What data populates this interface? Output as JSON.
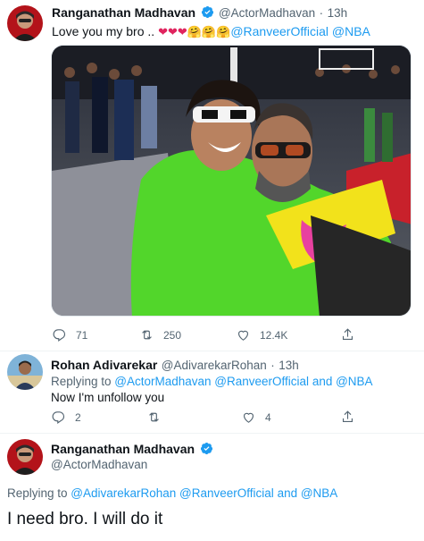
{
  "tweet1": {
    "name": "Ranganathan Madhavan",
    "handle": "@ActorMadhavan",
    "sep": "·",
    "time": "13h",
    "text_prefix": "Love you my bro .. ",
    "emojis": "❤❤❤🤗🤗🤗",
    "mention1": "@RanveerOfficial",
    "mention2": "@NBA",
    "replies": "71",
    "retweets": "250",
    "likes": "12.4K"
  },
  "tweet2": {
    "name": "Rohan Adivarekar",
    "handle": "@AdivarekarRohan",
    "sep": "·",
    "time": "13h",
    "replying_prefix": "Replying to ",
    "replying_links": "@ActorMadhavan @RanveerOfficial",
    "replying_and": " and ",
    "replying_nba": "@NBA",
    "text": "Now I'm unfollow you",
    "replies": "2",
    "retweets": "",
    "likes": "4"
  },
  "tweet3": {
    "name": "Ranganathan Madhavan",
    "handle": "@ActorMadhavan",
    "replying_prefix": "Replying to ",
    "replying_links": "@AdivarekarRohan @RanveerOfficial",
    "replying_and": " and ",
    "replying_nba": "@NBA",
    "text": "I need bro. I will do it"
  },
  "colors": {
    "accent": "#1d9bf0",
    "jacket_green": "#52d62b",
    "court_red": "#c8212b"
  },
  "icons": [
    "verified-badge-icon",
    "reply-icon",
    "retweet-icon",
    "like-icon",
    "share-icon",
    "more-icon"
  ]
}
